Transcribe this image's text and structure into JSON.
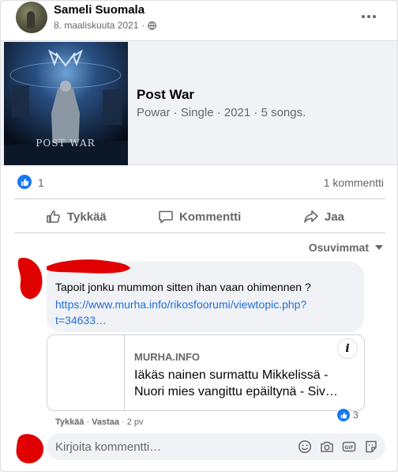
{
  "post": {
    "author": "Sameli Suomala",
    "date": "8. maaliskuuta 2021",
    "visibility_icon": "globe-icon",
    "menu_icon": "more-horizontal-icon"
  },
  "attachment": {
    "title": "Post War",
    "subtitle": "Powar · Single · 2021 · 5 songs.",
    "cover_text": "POST WAR"
  },
  "reactions": {
    "likes": "1",
    "comments": "1 kommentti"
  },
  "actions": {
    "like": "Tykkää",
    "comment": "Kommentti",
    "share": "Jaa"
  },
  "sort_label": "Osuvimmat",
  "comment": {
    "text": "Tapoit jonku mummon sitten ihan vaan ohimennen ?",
    "link": "https://www.murha.info/rikosfoorumi/viewtopic.php?t=34633…",
    "preview_domain": "MURHA.INFO",
    "preview_title_1": "Iäkäs nainen surmattu Mikkelissä -",
    "preview_title_2": "Nuori mies vangittu epäiltynä - Siv…",
    "info_label": "i",
    "like_action": "Tykkää",
    "reply_action": "Vastaa",
    "age": "2 pv",
    "reaction_count": "3"
  },
  "composer": {
    "placeholder": "Kirjoita kommentti…",
    "icons": [
      "emoji-icon",
      "camera-icon",
      "gif-icon",
      "sticker-icon"
    ]
  },
  "colors": {
    "accent": "#1877f2",
    "link": "#216fdb",
    "secondary_text": "#65676b",
    "redaction": "#e00000"
  }
}
